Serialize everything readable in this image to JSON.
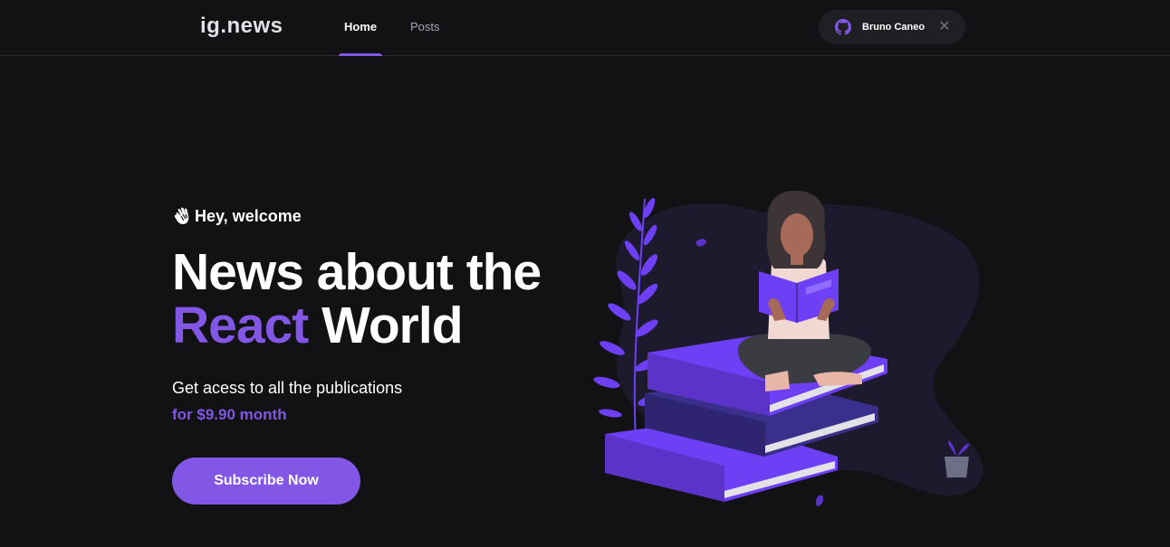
{
  "header": {
    "logo": "ig.news",
    "nav": [
      {
        "label": "Home",
        "active": true
      },
      {
        "label": "Posts",
        "active": false
      }
    ],
    "user": {
      "name": "Bruno Caneo",
      "icon": "github-icon",
      "close_icon": "close-icon"
    }
  },
  "hero": {
    "greeting_icon": "waving-hand-icon",
    "greeting": "Hey, welcome",
    "headline_line1": "News about the",
    "headline_accent": "React",
    "headline_rest": " World",
    "subtitle": "Get acess to all the publications",
    "price": "for $9.90 month",
    "cta_label": "Subscribe Now"
  },
  "colors": {
    "background": "#121214",
    "accent": "#8257e5",
    "pill": "#202024",
    "text": "#ffffff",
    "muted": "#a8a8b3"
  }
}
